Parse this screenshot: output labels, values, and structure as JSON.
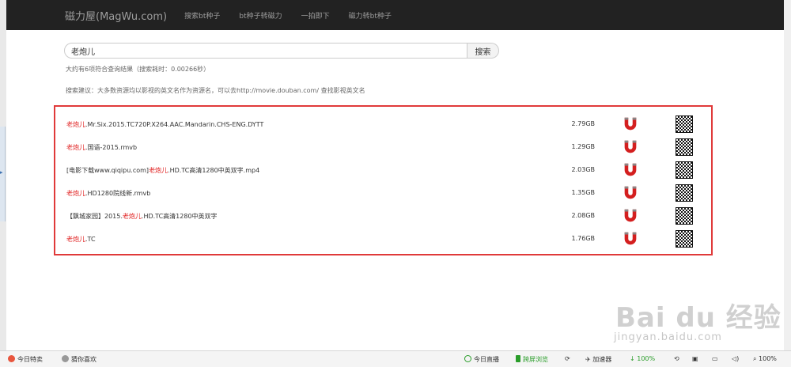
{
  "nav": {
    "brand": "磁力屋(MagWu.com)",
    "links": [
      "搜索bt种子",
      "bt种子转磁力",
      "一拍即下",
      "磁力转bt种子"
    ]
  },
  "search": {
    "query": "老炮儿",
    "button_label": "搜索",
    "result_info": "大约有6项符合查询结果（搜索耗时：0.00266秒）",
    "suggestion": "搜索建议：大多数资源均以影视的英文名作为资源名，可以去http://movie.douban.com/ 查找影视英文名"
  },
  "results": [
    {
      "prefix": "",
      "highlight": "老炮儿",
      "suffix": ".Mr.Six.2015.TC720P.X264.AAC.Mandarin.CHS-ENG.DYTT",
      "size": "2.79GB"
    },
    {
      "prefix": "",
      "highlight": "老炮儿",
      "suffix": ".国语-2015.rmvb",
      "size": "1.29GB"
    },
    {
      "prefix": "[电影下载www.qiqipu.com]",
      "highlight": "老炮儿",
      "suffix": ".HD.TC高清1280中英双字.mp4",
      "size": "2.03GB"
    },
    {
      "prefix": "",
      "highlight": "老炮儿",
      "suffix": ".HD1280院线新.rmvb",
      "size": "1.35GB"
    },
    {
      "prefix": "【飘城家园】2015.",
      "highlight": "老炮儿",
      "suffix": ".HD.TC高清1280中英双字",
      "size": "2.08GB"
    },
    {
      "prefix": "",
      "highlight": "老炮儿",
      "suffix": ".TC",
      "size": "1.76GB"
    }
  ],
  "watermark": {
    "logo": "Bai du 经验",
    "url": "jingyan.baidu.com"
  },
  "statusbar": {
    "left1": "今日特卖",
    "left2": "猜你喜欢",
    "live": "今日直播",
    "cross_screen": "跨屏浏览",
    "accelerator": "加速器",
    "download": "100%",
    "zoom": "100%"
  },
  "colors": {
    "highlight": "#e02020",
    "border": "#e03a3a",
    "nav_bg": "#222222",
    "magnet_red": "#d41f1f"
  }
}
